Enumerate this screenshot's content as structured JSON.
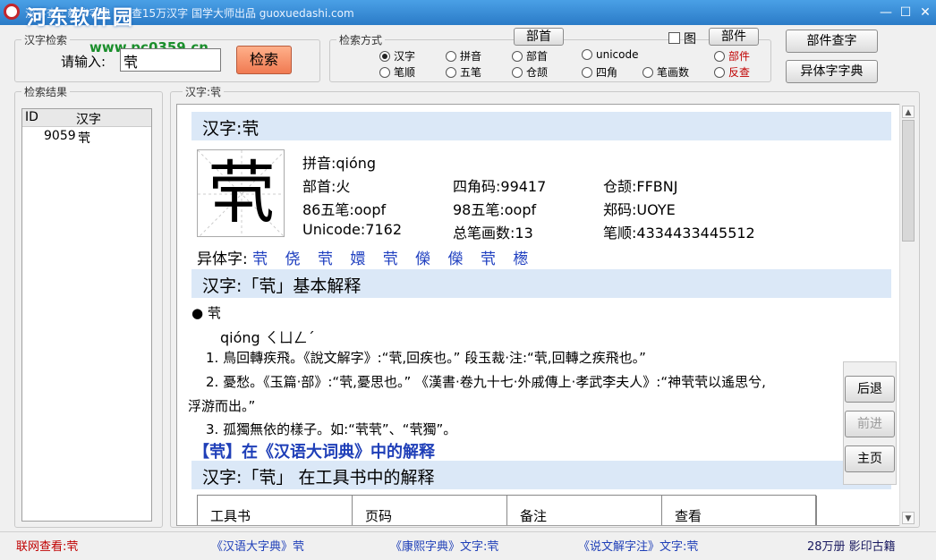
{
  "window": {
    "title": "汉字查 · 新华字典 · 可查15万汉字 国学大师出品 guoxuedashi.com",
    "watermark": "河东软件园",
    "watermark_url": "www.pc0359.cn",
    "min_glyph": "—",
    "max_glyph": "☐",
    "close_glyph": "✕"
  },
  "search": {
    "group_title": "汉字检索",
    "input_label": "请输入:",
    "input_value": "茕",
    "search_button": "检索"
  },
  "mode": {
    "group_title": "检索方式",
    "radicals_button": "部首",
    "components_button": "部件",
    "picture_checkbox_label": "图",
    "options": [
      {
        "label": "汉字",
        "selected": true
      },
      {
        "label": "拼音",
        "selected": false
      },
      {
        "label": "部首",
        "selected": false
      },
      {
        "label": "unicode",
        "selected": false
      },
      {
        "label": "部件",
        "selected": false,
        "red": true
      },
      {
        "label": "笔顺",
        "selected": false
      },
      {
        "label": "五笔",
        "selected": false
      },
      {
        "label": "仓颉",
        "selected": false
      },
      {
        "label": "四角",
        "selected": false
      },
      {
        "label": "笔画数",
        "selected": false
      },
      {
        "label": "反查",
        "selected": false,
        "red": true
      }
    ]
  },
  "right_buttons": {
    "component_lookup": "部件查字",
    "variant_dictionary": "异体字字典"
  },
  "results": {
    "group_title": "检索结果",
    "columns": [
      "ID",
      "汉字"
    ],
    "rows": [
      {
        "id": "9059",
        "char": "茕"
      }
    ]
  },
  "detail": {
    "group_title": "汉字:茕",
    "header": "汉字:茕",
    "character": "茕",
    "pinyin": "拼音:qióng",
    "radical": "部首:火",
    "four_corner": "四角码:99417",
    "cangjie": "仓颉:FFBNJ",
    "wubi86": "86五笔:oopf",
    "wubi98": "98五笔:oopf",
    "zhengma": "郑码:UOYE",
    "unicode": "Unicode:7162",
    "stroke_count": "总笔画数:13",
    "stroke_order": "笔顺:4334433445512",
    "variants_label": "异体字:",
    "variants": [
      "茕",
      "侥",
      "茕",
      "嬛",
      "茕",
      "儝",
      "儝",
      "茕",
      "檧"
    ],
    "basic_header": "汉字:「茕」基本解释",
    "bullet": "● 茕",
    "pronunciation": "qióng ㄑㄩㄥˊ",
    "definitions": [
      "1. 鳥回轉疾飛。《說文解字》:“茕,回疾也。” 段玉裁·注:“茕,回轉之疾飛也。”",
      "2. 憂愁。《玉篇·部》:“茕,憂思也。” 《漢書·卷九十七·外戚傳上·孝武李夫人》:“神茕茕以遙思兮,",
      "浮游而出。”",
      "3. 孤獨無依的樣子。如:“茕茕”、“茕獨”。"
    ],
    "ciyuan_link": "【茕】在《汉语大词典》中的解释",
    "tools_header": "汉字:「茕」 在工具书中的解释",
    "table_columns": [
      "工具书",
      "页码",
      "备注",
      "查看"
    ]
  },
  "nav": {
    "back": "后退",
    "forward": "前进",
    "home": "主页"
  },
  "status": {
    "online": "联网查看:茕",
    "hanyu": "《汉语大字典》茕",
    "kangxi": "《康熙字典》文字:茕",
    "shuowen": "《说文解字注》文字:茕",
    "books": "28万册 影印古籍"
  }
}
